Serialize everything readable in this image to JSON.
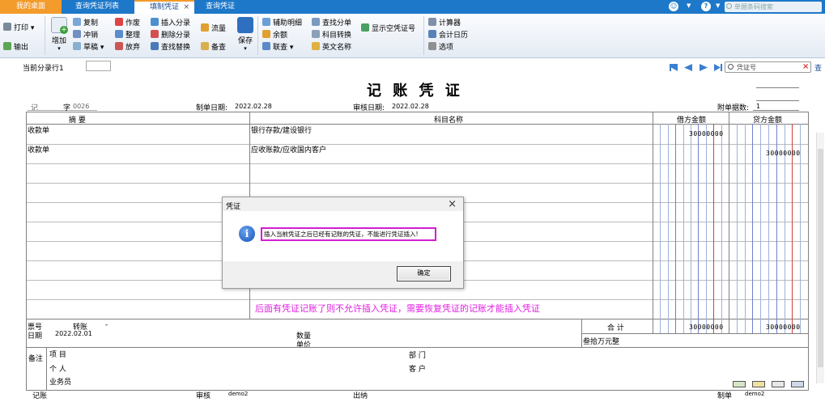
{
  "tabs": {
    "home": "我的桌面",
    "list": "查询凭证列表",
    "fill": "填制凭证",
    "fill_close": "×",
    "query": "查询凭证"
  },
  "topbar": {
    "search_placeholder": "单据条码搜索",
    "help": "?",
    "user_icon": "☺",
    "arrow": "▼"
  },
  "ribbon": {
    "print": "打印",
    "export": "输出",
    "add": "增加",
    "copy": "复制",
    "reverse": "冲销",
    "draft": "草稿",
    "void": "作废",
    "tidy": "整理",
    "abandon": "放弃",
    "insert_entry": "插入分录",
    "delete_entry": "删除分录",
    "find_replace": "查找替换",
    "flow": "流量",
    "memo": "备查",
    "save": "保存",
    "aux_detail": "辅助明细",
    "balance": "余额",
    "linked_query": "联查",
    "find_entry": "查找分单",
    "subject_convert": "科目转换",
    "english_name": "英文名称",
    "show_empty": "显示空凭证号",
    "calculator": "计算器",
    "acct_calendar": "会计日历",
    "options": "选项"
  },
  "nav": {
    "current_row_label": "当前分录行1",
    "current_row_value": "",
    "voucher_search_placeholder": "凭证号",
    "clear": "×",
    "query_link": "查"
  },
  "voucher": {
    "title": "记 账 凭 证",
    "type": "记",
    "number_label": "字",
    "number": "0026",
    "date_label": "制单日期:",
    "date": "2022.02.28",
    "audit_date_label": "审核日期:",
    "audit_date": "2022.02.28",
    "attachments_label": "附单据数:",
    "attachments": "1",
    "headers": {
      "summary": "摘 要",
      "subject": "科目名称",
      "debit": "借方金额",
      "credit": "贷方金额"
    },
    "rows": [
      {
        "summary": "收款单",
        "subject": "银行存款/建设银行",
        "debit": "30000000",
        "credit": ""
      },
      {
        "summary": "收款单",
        "subject": "应收账款/应收国内客户",
        "debit": "",
        "credit": "30000000"
      }
    ],
    "footer": {
      "ticket_label": "票号",
      "ticket_value": "转账",
      "ticket_dash": "-",
      "date_label": "日期",
      "date_value": "2022.02.01",
      "qty_label": "数量",
      "unit_price_label": "单价",
      "total_label": "合 计",
      "total_debit": "30000000",
      "total_credit": "30000000",
      "total_words": "叁拾万元整",
      "remark_label": "备注",
      "project_label": "项 目",
      "person_label": "个 人",
      "salesman_label": "业务员",
      "dept_label": "部 门",
      "customer_label": "客 户"
    },
    "sign": {
      "bookkeep_label": "记账",
      "audit_label": "审核",
      "auditor": "demo2",
      "cashier_label": "出纳",
      "maker_label": "制单",
      "maker": "demo2"
    }
  },
  "dialog": {
    "title": "凭证",
    "close": "×",
    "message": "插入当前凭证之后已经有记账的凭证，不能进行凭证插入!",
    "ok": "确定",
    "icon": "i"
  },
  "annotation": "后面有凭证记账了则不允许插入凭证，需要恢复凭证的记账才能插入凭证"
}
